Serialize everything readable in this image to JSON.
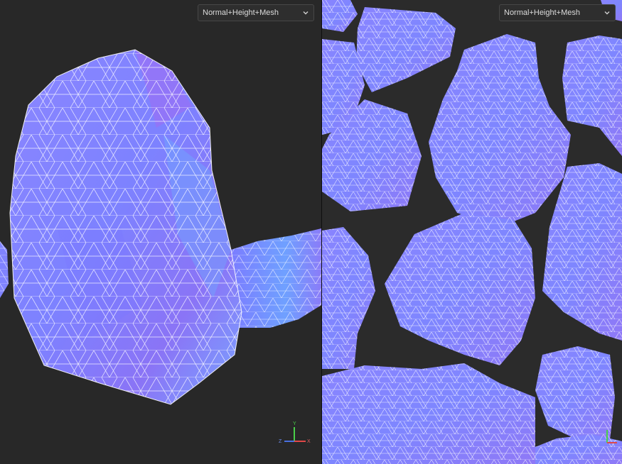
{
  "left_viewport": {
    "mode": "Normal+Height+Mesh",
    "axes": {
      "y": "Y",
      "z": "Z",
      "x": "X"
    }
  },
  "right_viewport": {
    "mode": "Normal+Height+Mesh",
    "axes": {
      "y": "Y",
      "z": "Z",
      "x": "X"
    }
  },
  "colors": {
    "background": "#282828",
    "normal_blue": "#7f7fff",
    "normal_violet": "#9a6cf0",
    "normal_cyan": "#7fd0ff",
    "mesh_wire": "#ffffff",
    "axis_x": "#e04848",
    "axis_y": "#4ad04a",
    "axis_z": "#4a70e0"
  }
}
